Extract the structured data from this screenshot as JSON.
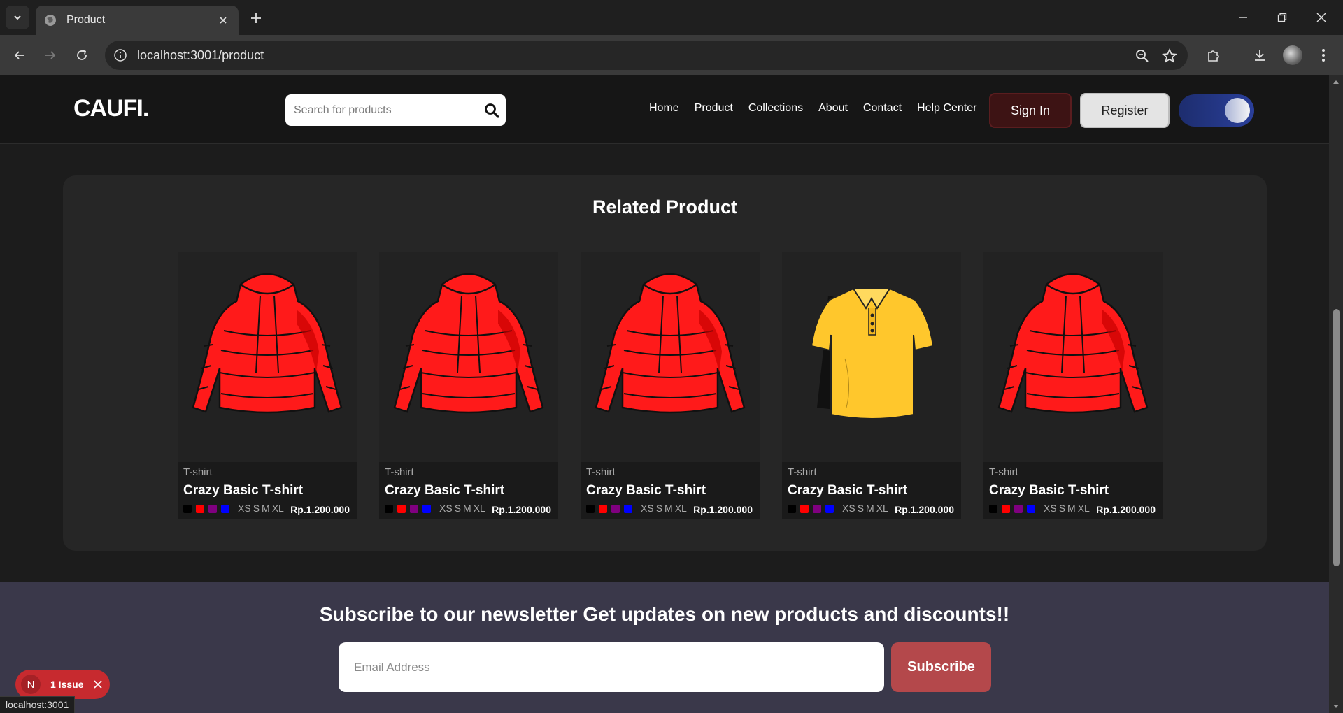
{
  "browser": {
    "tab_title": "Product",
    "url": "localhost:3001/product",
    "status_url": "localhost:3001"
  },
  "header": {
    "logo": "CAUFI.",
    "search_placeholder": "Search for products",
    "nav": [
      "Home",
      "Product",
      "Collections",
      "About",
      "Contact",
      "Help Center"
    ],
    "signin_label": "Sign In",
    "register_label": "Register"
  },
  "related": {
    "title": "Related Product",
    "products": [
      {
        "category": "T-shirt",
        "name": "Crazy Basic T-shirt",
        "price": "Rp.1.200.000",
        "image": "red-puffer-jacket"
      },
      {
        "category": "T-shirt",
        "name": "Crazy Basic T-shirt",
        "price": "Rp.1.200.000",
        "image": "red-puffer-jacket"
      },
      {
        "category": "T-shirt",
        "name": "Crazy Basic T-shirt",
        "price": "Rp.1.200.000",
        "image": "red-puffer-jacket"
      },
      {
        "category": "T-shirt",
        "name": "Crazy Basic T-shirt",
        "price": "Rp.1.200.000",
        "image": "yellow-polo-shirt"
      },
      {
        "category": "T-shirt",
        "name": "Crazy Basic T-shirt",
        "price": "Rp.1.200.000",
        "image": "red-puffer-jacket"
      }
    ],
    "sizes": [
      "XS",
      "S",
      "M",
      "XL"
    ],
    "swatch_colors": [
      "#000000",
      "#ff0000",
      "#800080",
      "#0000ff"
    ]
  },
  "newsletter": {
    "title": "Subscribe to our newsletter Get updates on new products and discounts!!",
    "email_placeholder": "Email Address",
    "subscribe_label": "Subscribe"
  },
  "dev_overlay": {
    "logo_letter": "N",
    "issue_label": "1 Issue"
  },
  "colors": {
    "accent_red": "#b4484b",
    "signin_bg": "#3d1314",
    "toggle": "#2a3f9a"
  }
}
